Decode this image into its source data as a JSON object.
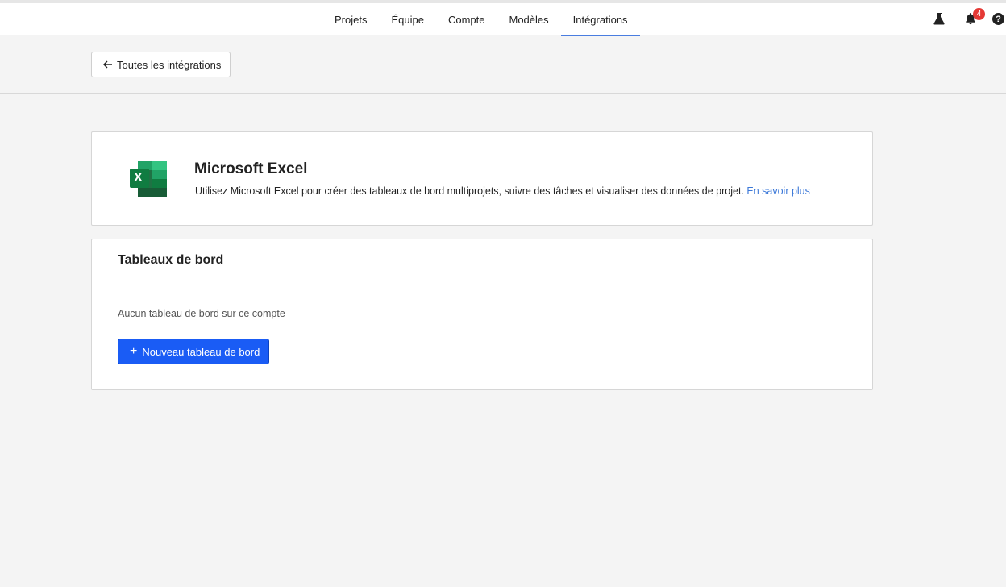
{
  "nav": {
    "tabs": [
      {
        "label": "Projets"
      },
      {
        "label": "Équipe"
      },
      {
        "label": "Compte"
      },
      {
        "label": "Modèles"
      },
      {
        "label": "Intégrations"
      }
    ],
    "active_tab": "Intégrations",
    "notification_count": "4",
    "help_label": "?",
    "icons": [
      "flask-icon",
      "bell-icon",
      "help-icon"
    ],
    "accent_color": "#4a7de0"
  },
  "subbar": {
    "back_label": "Toutes les intégrations",
    "back_icon": "arrow-left-icon"
  },
  "integration": {
    "title": "Microsoft Excel",
    "description": "Utilisez Microsoft Excel pour créer des tableaux de bord multiprojets, suivre des tâches et visualiser des données de projet.",
    "learn_more": "En savoir plus",
    "logo_icon": "excel-logo-icon",
    "logo_letter": "X"
  },
  "dashboards": {
    "heading": "Tableaux de bord",
    "empty_text": "Aucun tableau de bord sur ce compte",
    "new_button_label": "Nouveau tableau de bord",
    "new_button_icon": "plus-icon",
    "button_color": "#1a5cf5"
  }
}
